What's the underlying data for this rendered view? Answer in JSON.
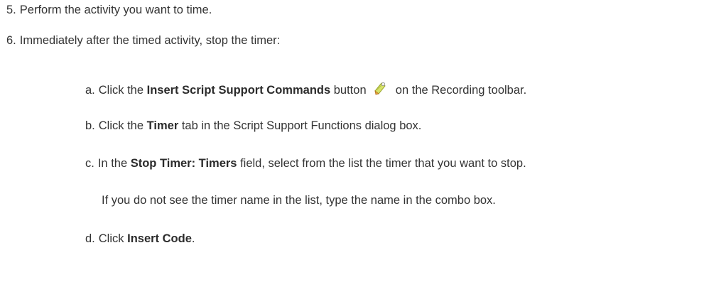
{
  "steps": [
    {
      "number": "5.",
      "text": "Perform the activity you want to time."
    },
    {
      "number": "6.",
      "text": "Immediately after the timed activity, stop the timer:"
    }
  ],
  "substeps": {
    "a": {
      "marker": "a.",
      "pre": "Click the ",
      "bold": "Insert Script Support Commands",
      "mid": " button",
      "post": " on the Recording toolbar.",
      "icon": "script-support-icon"
    },
    "b": {
      "marker": "b.",
      "pre": "Click the ",
      "bold": "Timer",
      "post": " tab in the Script Support Functions dialog box."
    },
    "c": {
      "marker": "c.",
      "pre": "In the ",
      "bold": "Stop Timer: Timers",
      "post": " field, select from the list the timer that you want to stop."
    },
    "c_note": "If you do not see the timer name in the list, type the name in the combo box.",
    "d": {
      "marker": "d.",
      "pre": "Click ",
      "bold": "Insert Code",
      "post": "."
    }
  }
}
